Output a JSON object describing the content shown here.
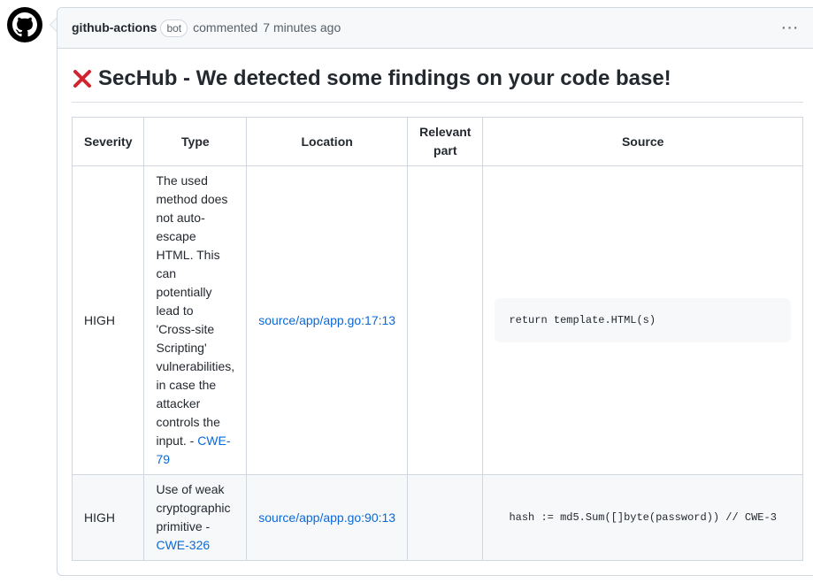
{
  "comment": {
    "author": "github-actions",
    "bot_label": "bot",
    "action_text": "commented",
    "timestamp": "7 minutes ago"
  },
  "heading": {
    "text": "SecHub - We detected some findings on your code base!"
  },
  "table": {
    "headers": {
      "severity": "Severity",
      "type": "Type",
      "location": "Location",
      "relevant": "Relevant part",
      "source": "Source"
    },
    "rows": [
      {
        "severity": "HIGH",
        "type_text": "The used method does not auto-escape HTML. This can potentially lead to 'Cross-site Scripting' vulnerabilities, in case the attacker controls the input. - ",
        "type_link": "CWE-79",
        "location": "source/app/app.go:17:13",
        "relevant": "",
        "source": "return template.HTML(s)"
      },
      {
        "severity": "HIGH",
        "type_text": "Use of weak cryptographic primitive - ",
        "type_link": "CWE-326",
        "location": "source/app/app.go:90:13",
        "relevant": "",
        "source": "hash := md5.Sum([]byte(password)) // CWE-3"
      }
    ]
  }
}
